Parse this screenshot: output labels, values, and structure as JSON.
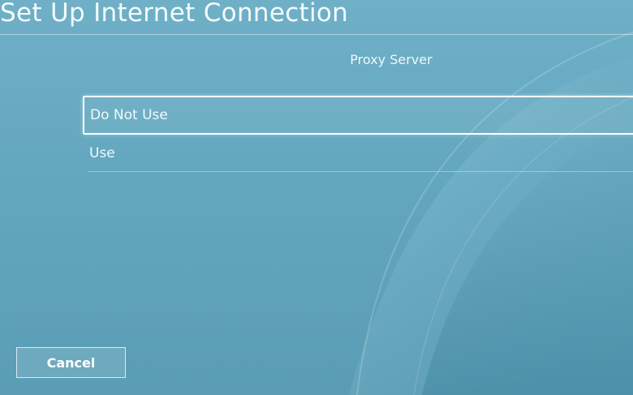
{
  "window": {
    "title": "Set Up Internet Connection"
  },
  "main": {
    "heading": "Proxy Server",
    "options": [
      {
        "label": "Do Not Use",
        "selected": true
      },
      {
        "label": "Use",
        "selected": false
      }
    ]
  },
  "footer": {
    "cancel_label": "Cancel"
  },
  "colors": {
    "background": "#63a7bf",
    "highlight_border": "#ffffff"
  }
}
